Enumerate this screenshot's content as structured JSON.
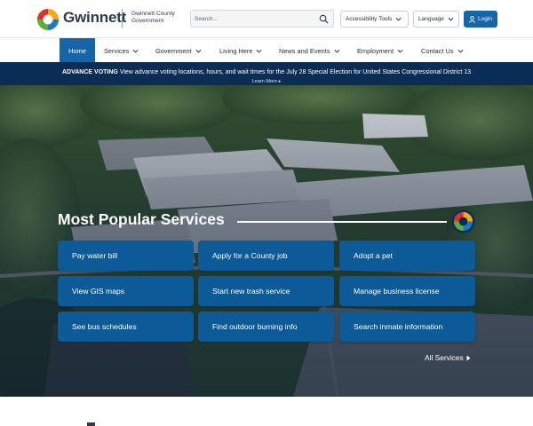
{
  "header": {
    "brand": "Gwinnett",
    "subtitle": "Gwinnett County Government",
    "search_placeholder": "Search...",
    "accessibility_label": "Accessibility Tools",
    "language_label": "Language",
    "login_label": "Login"
  },
  "nav": {
    "items": [
      {
        "label": "Home"
      },
      {
        "label": "Services"
      },
      {
        "label": "Government"
      },
      {
        "label": "Living Here"
      },
      {
        "label": "News and Events"
      },
      {
        "label": "Employment"
      },
      {
        "label": "Contact Us"
      }
    ]
  },
  "alert": {
    "label": "ADVANCE VOTING",
    "message": "View advance voting locations, hours, and wait times for the July 28 Special Election for United States Congressional District 13",
    "link": "Learn More"
  },
  "hero": {
    "title": "Most Popular Services",
    "tiles": [
      {
        "label": "Pay water bill"
      },
      {
        "label": "Apply for a County job"
      },
      {
        "label": "Adopt a pet"
      },
      {
        "label": "View GIS maps"
      },
      {
        "label": "Start new trash service"
      },
      {
        "label": "Manage business license"
      },
      {
        "label": "See bus schedules"
      },
      {
        "label": "Find outdoor burning info"
      },
      {
        "label": "Search inmate information"
      }
    ],
    "all_services": "All Services"
  },
  "colors": {
    "primary": "#1565a7",
    "tile": "#0c5a98",
    "alert": "#0a2d55"
  }
}
